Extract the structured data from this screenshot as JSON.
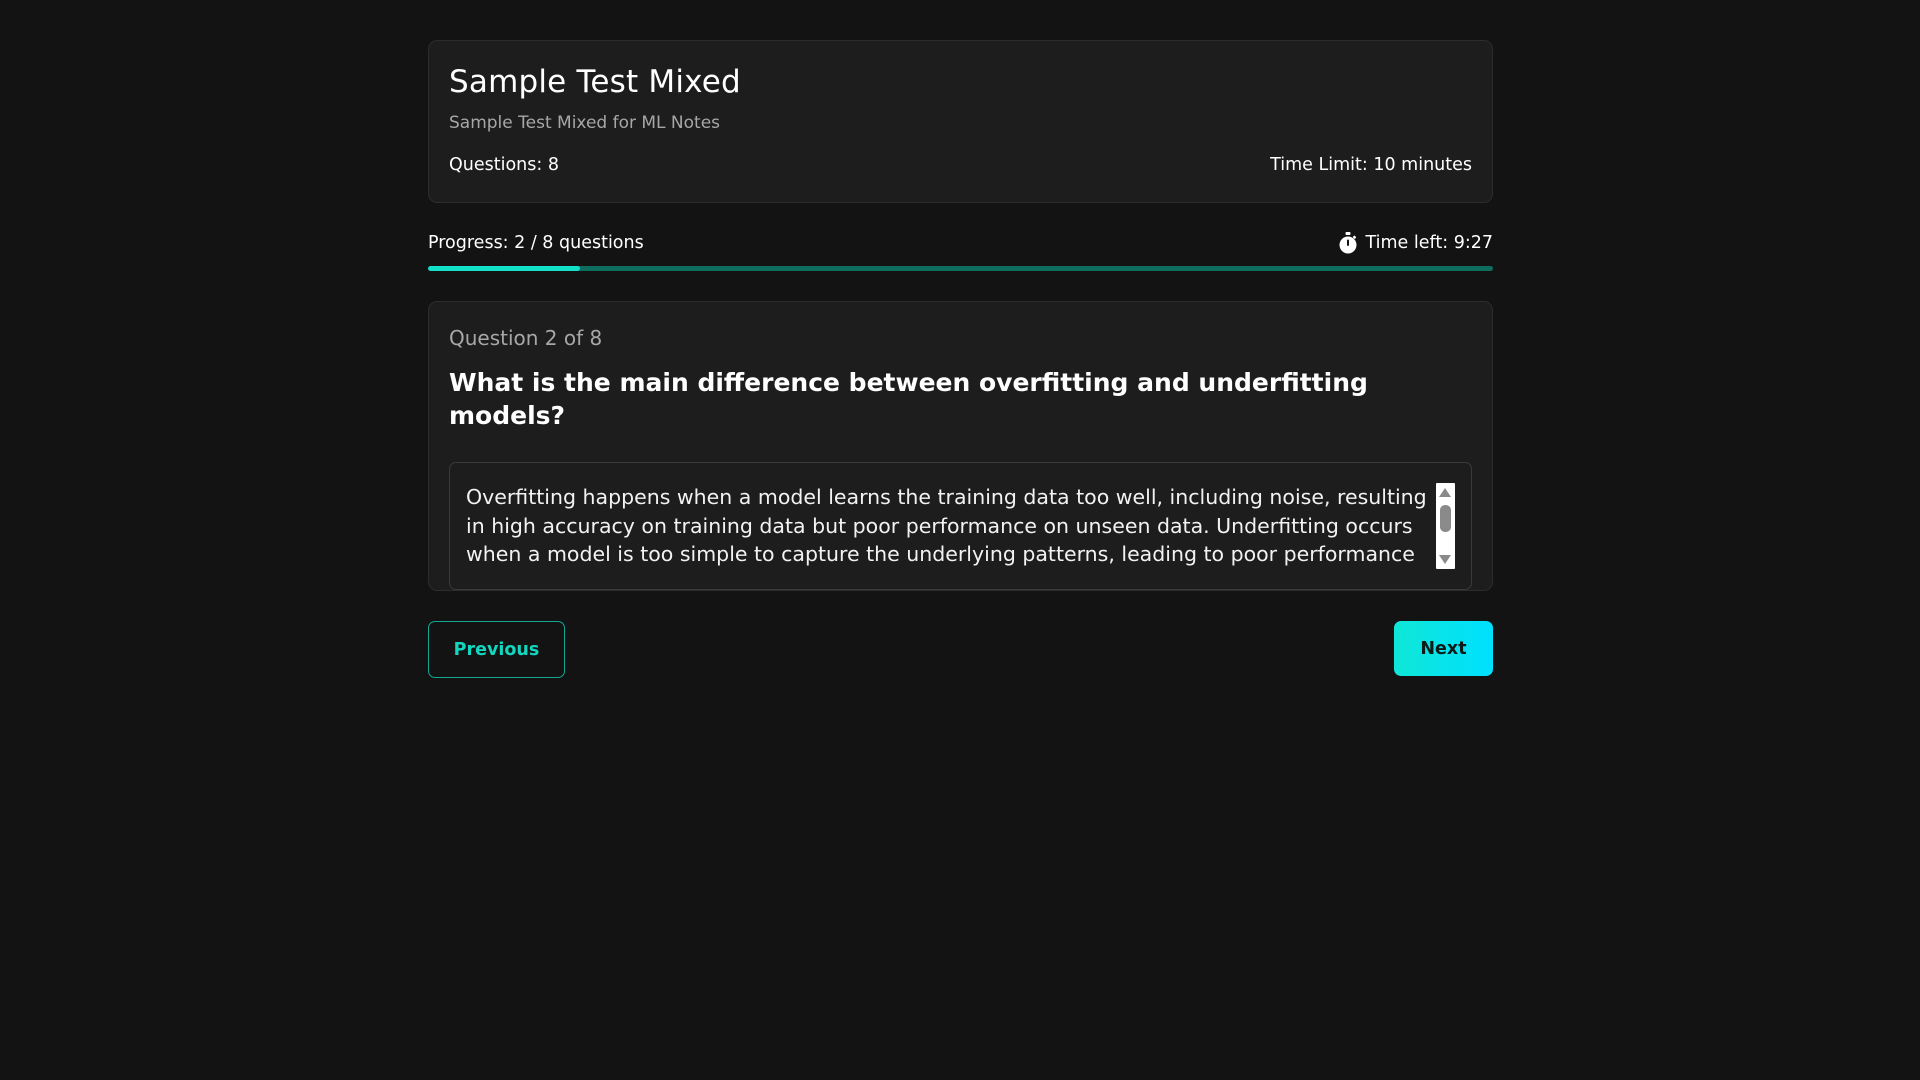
{
  "test": {
    "title": "Sample Test Mixed",
    "description": "Sample Test Mixed for ML Notes",
    "questions_label": "Questions: 8",
    "time_limit_label": "Time Limit: 10 minutes"
  },
  "progress": {
    "label": "Progress: 2 / 8 questions",
    "fraction": 0.143,
    "timer_icon": "stopwatch-icon",
    "time_left_label": "Time left: 9:27"
  },
  "question": {
    "counter": "Question 2 of 8",
    "text": "What is the main difference between overfitting and underfitting models?",
    "answer": "Overfitting happens when a model learns the training data too well, including noise, resulting in high accuracy on training data but poor performance on unseen data. Underfitting occurs when a model is too simple to capture the underlying patterns, leading to poor performance on both"
  },
  "nav": {
    "previous_label": "Previous",
    "next_label": "Next"
  },
  "colors": {
    "background": "#131313",
    "card": "#1d1d1d",
    "accent": "#12e0c8",
    "progress_track": "#0f6d60"
  }
}
